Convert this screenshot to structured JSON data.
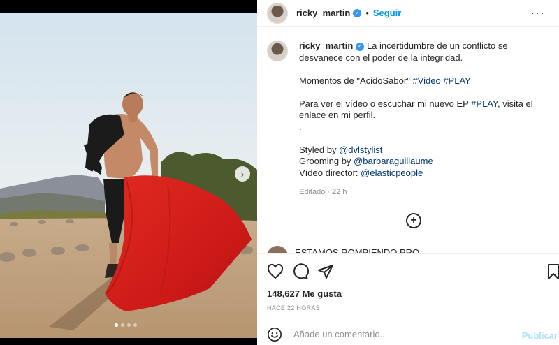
{
  "post": {
    "username": "ricky_martin",
    "follow_label": "Seguir",
    "separator": "•",
    "more_label": "···",
    "caption": {
      "line1": "La incertidumbre de un conflicto se desvanece con el poder de la integridad.",
      "moments_prefix": "Momentos de \"AcidoSabor\" ",
      "hashtag_video": "#Video",
      "hashtag_play": "#PLAY",
      "ep_prefix": "Para ver el vídeo o escuchar mi nuevo EP ",
      "ep_suffix": ", visita el enlace en mi perfil.",
      "dot": ".",
      "styled_prefix": "Styled by ",
      "styled_handle": "@dvlstylist",
      "grooming_prefix": "Grooming by ",
      "grooming_handle": "@barbaraguillaume",
      "director_prefix": "Vídeo director: ",
      "director_handle": "@elasticpeople"
    },
    "edited_label": "Editado · 22 h",
    "load_more_icon": "plus-circle-icon",
    "comment_preview": "ESTAMOS ROMPIENDO PRO",
    "likes_label": "148,627 Me gusta",
    "time_label": "HACE 22 HORAS",
    "comment_placeholder": "Añade un comentario...",
    "publish_label": "Publicar"
  },
  "carousel": {
    "total": 4,
    "active": 1
  },
  "colors": {
    "accent": "#0095f6",
    "cape_red": "#d11d1d",
    "hashtag": "#00376b"
  }
}
